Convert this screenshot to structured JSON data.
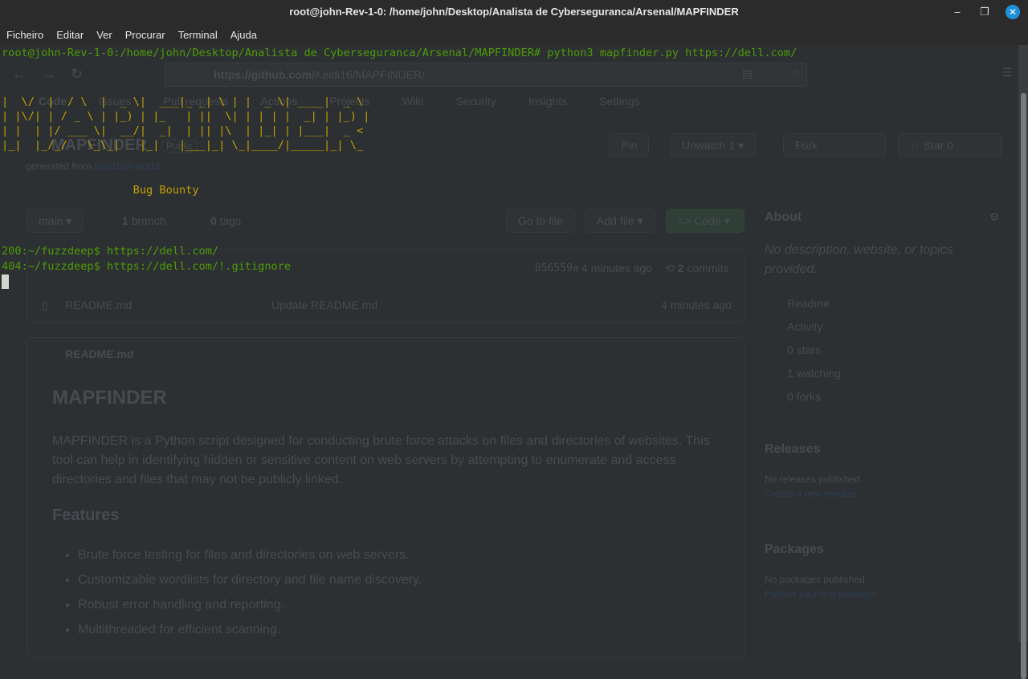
{
  "window": {
    "title": "root@john-Rev-1-0: /home/john/Desktop/Analista de Cyberseguranca/Arsenal/MAPFINDER",
    "minimize": "–",
    "maximize": "❐",
    "close": "✕"
  },
  "menu": [
    "Ficheiro",
    "Editar",
    "Ver",
    "Procurar",
    "Terminal",
    "Ajuda"
  ],
  "terminal": {
    "command_line": "root@john-Rev-1-0:/home/john/Desktop/Analista de Cyberseguranca/Arsenal/MAPFINDER# python3 mapfinder.py https://dell.com/",
    "banner": [
      "|  \\/  |  / \\  |  _ \\|  ___|_ _| \\ | |  _ \\| ____|  _ \\",
      "| |\\/| | / _ \\ | |_) | |_   | ||  \\| | | | |  _| | |_) |",
      "| |  | |/ ___ \\|  __/|  _|  | || |\\  | |_| | |___|  _ <",
      "|_|  |_/_/   \\_\\_|   |_|   |___|_| \\_|____/|_____|_| \\_"
    ],
    "subtitle": "                    Bug Bounty",
    "results": [
      "200:~/fuzzdeep$ https://dell.com/",
      "404:~/fuzzdeep$ https://dell.com/!.gitignore"
    ],
    "colors": {
      "green": "#4e9a06",
      "yellow": "#c4a000"
    }
  },
  "browser": {
    "url_domain": "https://github.com/",
    "url_path": "Keidi16/MAPFINDER/",
    "tabs": [
      "Code",
      "Issues",
      "Pull requests",
      "Actions",
      "Projects",
      "Wiki",
      "Security",
      "Insights",
      "Settings"
    ],
    "repo_name": "MAPFINDER",
    "visibility": "Public",
    "generated_from": "generated from",
    "template": "Keidi16/Keidi16",
    "pin": "Pin",
    "unwatch": "Unwatch",
    "watch_count": "1",
    "fork": "Fork",
    "star": "Star",
    "star_count": "0",
    "branch": "main",
    "branches_n": "1",
    "branches": "branch",
    "tags_n": "0",
    "tags": "tags",
    "go_to_file": "Go to file",
    "add_file": "Add file",
    "code": "Code",
    "commit_hash": "056559a",
    "commit_time": "4 minutes ago",
    "commits_n": "2",
    "commits": "commits",
    "file_name": "README.md",
    "file_msg": "Update README.md",
    "file_time": "4 minutes ago",
    "readme_header": "README.md",
    "readme_title": "MAPFINDER",
    "readme_text": "MAPFINDER is a Python script designed for conducting brute force attacks on files and directories of websites. This tool can help in identifying hidden or sensitive content on web servers by attempting to enumerate and access directories and files that may not be publicly linked.",
    "features_title": "Features",
    "features": [
      "Brute force testing for files and directories on web servers.",
      "Customizable wordlists for directory and file name discovery.",
      "Robust error handling and reporting.",
      "Multithreaded for efficient scanning."
    ],
    "about": "About",
    "about_desc": "No description, website, or topics provided.",
    "about_items": [
      "Readme",
      "Activity",
      "0 stars",
      "1 watching",
      "0 forks"
    ],
    "releases": "Releases",
    "no_releases": "No releases published",
    "create_release": "Create a new release",
    "packages": "Packages",
    "no_packages": "No packages published",
    "publish_package": "Publish your first package"
  }
}
